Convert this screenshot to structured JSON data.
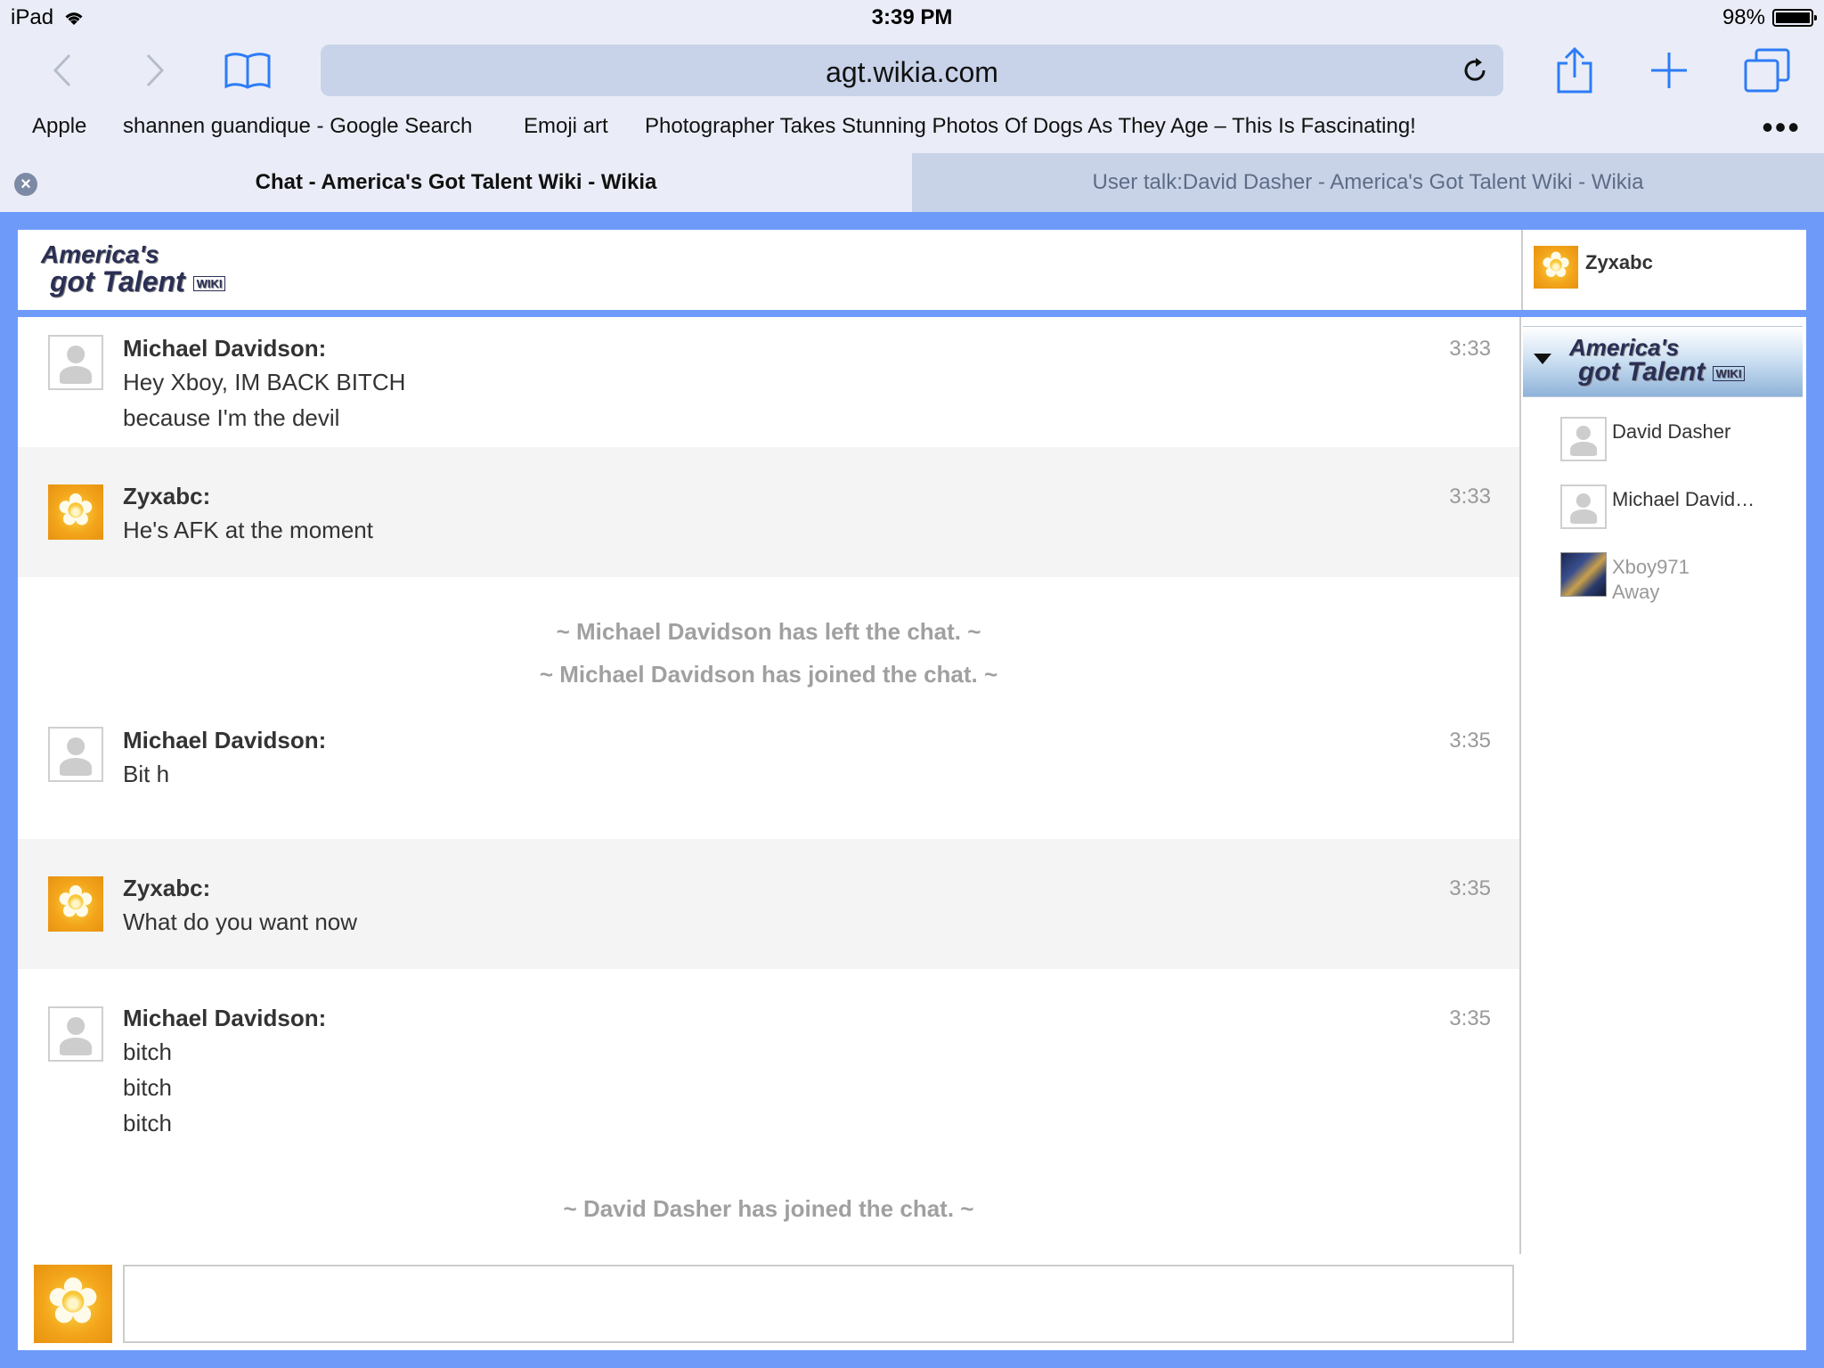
{
  "status_bar": {
    "device": "iPad",
    "time": "3:39 PM",
    "battery": "98%"
  },
  "browser": {
    "url": "agt.wikia.com",
    "bookmarks": [
      "Apple",
      "shannen guandique - Google Search",
      "Emoji art",
      "Photographer Takes Stunning Photos Of Dogs As They Age – This Is Fascinating!"
    ],
    "more": "•••",
    "tabs": [
      "Chat - America's Got Talent Wiki - Wikia",
      "User talk:David Dasher - America's Got Talent Wiki - Wikia"
    ]
  },
  "colors": {
    "accent": "#6e9bf9",
    "alt_row": "#f4f4f4",
    "inline_alert": "#a0a0a0"
  },
  "chat": {
    "current_user": "Zyxabc",
    "messages": [
      {
        "user": "Michael Davidson:",
        "lines": [
          "Hey Xboy, IM BACK BITCH",
          "because I'm the devil"
        ],
        "time": "3:33",
        "avatar": "default-avatar"
      },
      {
        "user": "Zyxabc:",
        "lines": [
          "He's AFK at the moment"
        ],
        "time": "3:33",
        "avatar": "flower-avatar"
      },
      {
        "user": "Michael Davidson:",
        "lines": [
          "Bit h"
        ],
        "time": "3:35",
        "avatar": "default-avatar"
      },
      {
        "user": "Zyxabc:",
        "lines": [
          "What do you want now"
        ],
        "time": "3:35",
        "avatar": "flower-avatar"
      },
      {
        "user": "Michael Davidson:",
        "lines": [
          "bitch",
          "bitch",
          "bitch"
        ],
        "time": "3:35",
        "avatar": "default-avatar"
      }
    ],
    "alerts": [
      "~ Michael Davidson has left the chat. ~",
      "~ Michael Davidson has joined the chat. ~",
      "~ David Dasher has joined the chat. ~"
    ],
    "users": [
      {
        "name": "David Dasher",
        "status": ""
      },
      {
        "name": "Michael David…",
        "status": ""
      },
      {
        "name": "Xboy971",
        "status": "Away"
      }
    ],
    "input_value": ""
  }
}
